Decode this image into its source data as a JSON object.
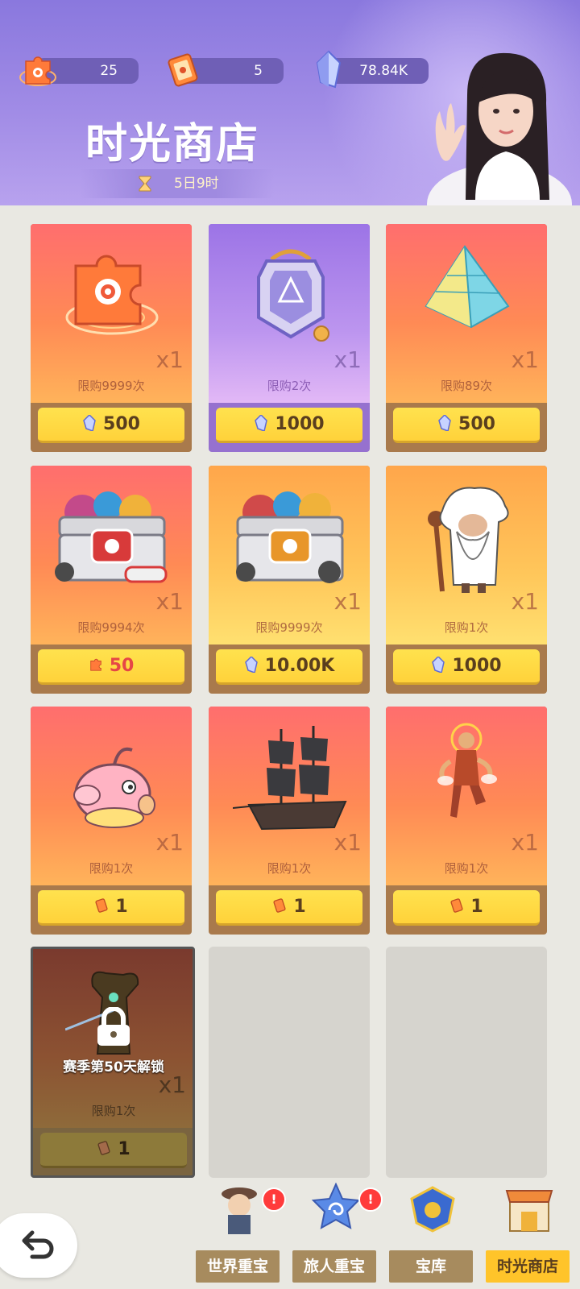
{
  "header": {
    "title": "时光商店",
    "timer": "5日9时",
    "resources": [
      {
        "name": "puzzle-token",
        "value": "25"
      },
      {
        "name": "ticket-token",
        "value": "5"
      },
      {
        "name": "crystal",
        "value": "78.84K"
      }
    ]
  },
  "items": [
    {
      "qty": "x1",
      "limit": "限购9999次",
      "price": "500",
      "currency": "crystal-icon",
      "style": "orange",
      "icon": "puzzle-piece-icon"
    },
    {
      "qty": "x1",
      "limit": "限购2次",
      "price": "1000",
      "currency": "crystal-icon",
      "style": "purple",
      "icon": "amulet-icon"
    },
    {
      "qty": "x1",
      "limit": "限购89次",
      "price": "500",
      "currency": "crystal-icon",
      "style": "orange",
      "icon": "pyramid-crystal-icon"
    },
    {
      "qty": "x1",
      "limit": "限购9994次",
      "price": "50",
      "currency": "puzzle-token-icon",
      "style": "orange",
      "icon": "treasure-chest-red-icon"
    },
    {
      "qty": "x1",
      "limit": "限购9999次",
      "price": "10.00K",
      "currency": "crystal-icon",
      "style": "yellow",
      "icon": "treasure-chest-gold-icon"
    },
    {
      "qty": "x1",
      "limit": "限购1次",
      "price": "1000",
      "currency": "crystal-icon",
      "style": "yellow",
      "icon": "old-sage-icon"
    },
    {
      "qty": "x1",
      "limit": "限购1次",
      "price": "1",
      "currency": "ticket-icon",
      "style": "orange",
      "icon": "pink-creature-icon"
    },
    {
      "qty": "x1",
      "limit": "限购1次",
      "price": "1",
      "currency": "ticket-icon",
      "style": "orange",
      "icon": "pirate-ship-icon"
    },
    {
      "qty": "x1",
      "limit": "限购1次",
      "price": "1",
      "currency": "ticket-icon",
      "style": "orange",
      "icon": "monkey-king-icon"
    },
    {
      "qty": "x1",
      "limit": "限购1次",
      "price": "1",
      "currency": "ticket-icon",
      "style": "locked",
      "icon": "tree-warrior-icon",
      "lock_text": "赛季第50天解锁"
    }
  ],
  "tabs": [
    {
      "label": "世界重宝",
      "badge": "!"
    },
    {
      "label": "旅人重宝",
      "badge": "!"
    },
    {
      "label": "宝库",
      "badge": ""
    },
    {
      "label": "时光商店",
      "badge": ""
    }
  ]
}
